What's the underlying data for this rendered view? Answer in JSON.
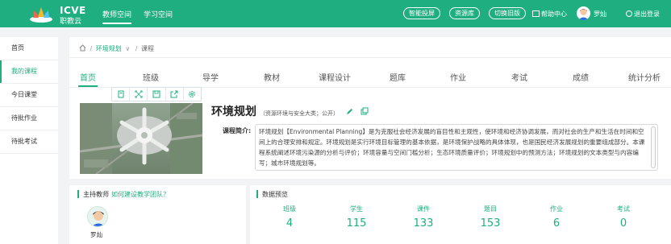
{
  "header": {
    "logo_text": "ICVE",
    "logo_subtext": "职教云",
    "nav": [
      "教师空间",
      "学习空间"
    ],
    "pills": [
      "智能投屏",
      "资源库",
      "切换旧版"
    ],
    "help_label": "帮助中心",
    "username": "罗灿",
    "logout_label": "退出登录"
  },
  "sidebar": {
    "items": [
      {
        "label": "首页",
        "active": false
      },
      {
        "label": "我的课程",
        "active": true
      },
      {
        "label": "今日课堂",
        "active": false
      },
      {
        "label": "待批作业",
        "active": false
      },
      {
        "label": "待批考试",
        "active": false
      }
    ]
  },
  "breadcrumb": {
    "sep1": "/",
    "course_link": "环境规划",
    "chevron": "∨",
    "sep2": "/",
    "current": "课程"
  },
  "tabs": [
    "首页",
    "班级",
    "导学",
    "教材",
    "课程设计",
    "题库",
    "作业",
    "考试",
    "成绩",
    "统计分析"
  ],
  "course": {
    "title": "环境规划",
    "meta": "（资源环境与安全大类；公开）",
    "intro_label": "课程简介:",
    "intro_text": "环境规划【Environmental Planning】是为克服社会经济发展的盲目性和主观性，使环境和经济协调发展，而对社会的生产和生活在时间和空间上的合理安排和规定。环境规划是实行环境目标管理的基本依据，是环境保护战略的具体体现，也是国民经济发展规划的重要组成部分。本课程系统阐述环境污染源的分析与评价；环境容量与空间门槛分析；生态环境质量评价；环境规划中的预测方法；环境规划的文本类型与内容编写；城市环境规划等。"
  },
  "teacher": {
    "heading": "主持教师",
    "link": "如何建设教学团队？",
    "name": "罗灿"
  },
  "stats": {
    "heading": "数据预览",
    "items": [
      {
        "label": "班级",
        "value": "4"
      },
      {
        "label": "学生",
        "value": "115"
      },
      {
        "label": "课件",
        "value": "133"
      },
      {
        "label": "题目",
        "value": "153"
      },
      {
        "label": "作业",
        "value": "6"
      },
      {
        "label": "考试",
        "value": "0"
      }
    ]
  },
  "colors": {
    "brand": "#1fae7f",
    "background": "#f2f3f5"
  }
}
